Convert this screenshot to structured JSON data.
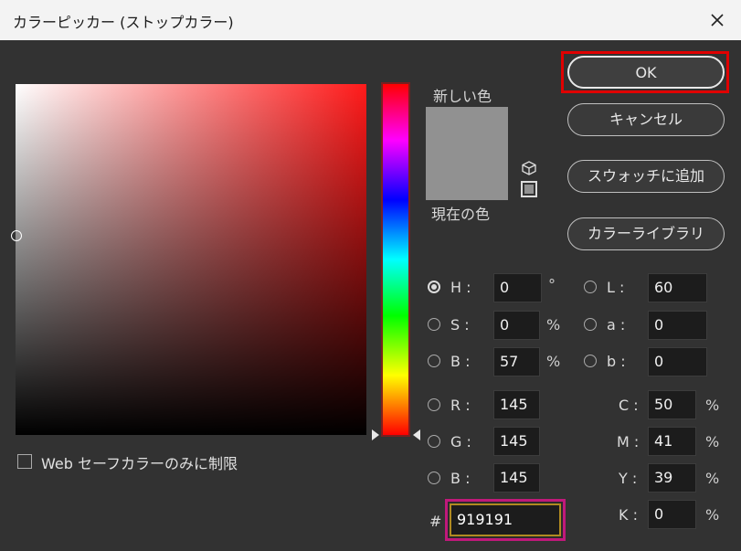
{
  "window": {
    "title": "カラーピッカー (ストップカラー)"
  },
  "preview": {
    "new_label": "新しい色",
    "current_label": "現在の色",
    "color": "#919191"
  },
  "buttons": {
    "ok": "OK",
    "cancel": "キャンセル",
    "add_swatch": "スウォッチに追加",
    "color_libraries": "カラーライブラリ"
  },
  "hsb": [
    {
      "key": "H",
      "value": "0",
      "unit": "°",
      "selected": true
    },
    {
      "key": "S",
      "value": "0",
      "unit": "%",
      "selected": false
    },
    {
      "key": "B",
      "value": "57",
      "unit": "%",
      "selected": false
    }
  ],
  "lab": [
    {
      "key": "L",
      "value": "60"
    },
    {
      "key": "a",
      "value": "0"
    },
    {
      "key": "b",
      "value": "0"
    }
  ],
  "rgb": [
    {
      "key": "R",
      "value": "145"
    },
    {
      "key": "G",
      "value": "145"
    },
    {
      "key": "B",
      "value": "145"
    }
  ],
  "cmyk": [
    {
      "key": "C",
      "value": "50",
      "unit": "%"
    },
    {
      "key": "M",
      "value": "41",
      "unit": "%"
    },
    {
      "key": "Y",
      "value": "39",
      "unit": "%"
    },
    {
      "key": "K",
      "value": "0",
      "unit": "%"
    }
  ],
  "hex": {
    "prefix": "#",
    "value": "919191"
  },
  "web_safe": {
    "label": "Web セーフカラーのみに制限",
    "checked": false
  },
  "colors": {
    "accent_red": "#e00000",
    "hex_highlight": "#c0197a"
  }
}
